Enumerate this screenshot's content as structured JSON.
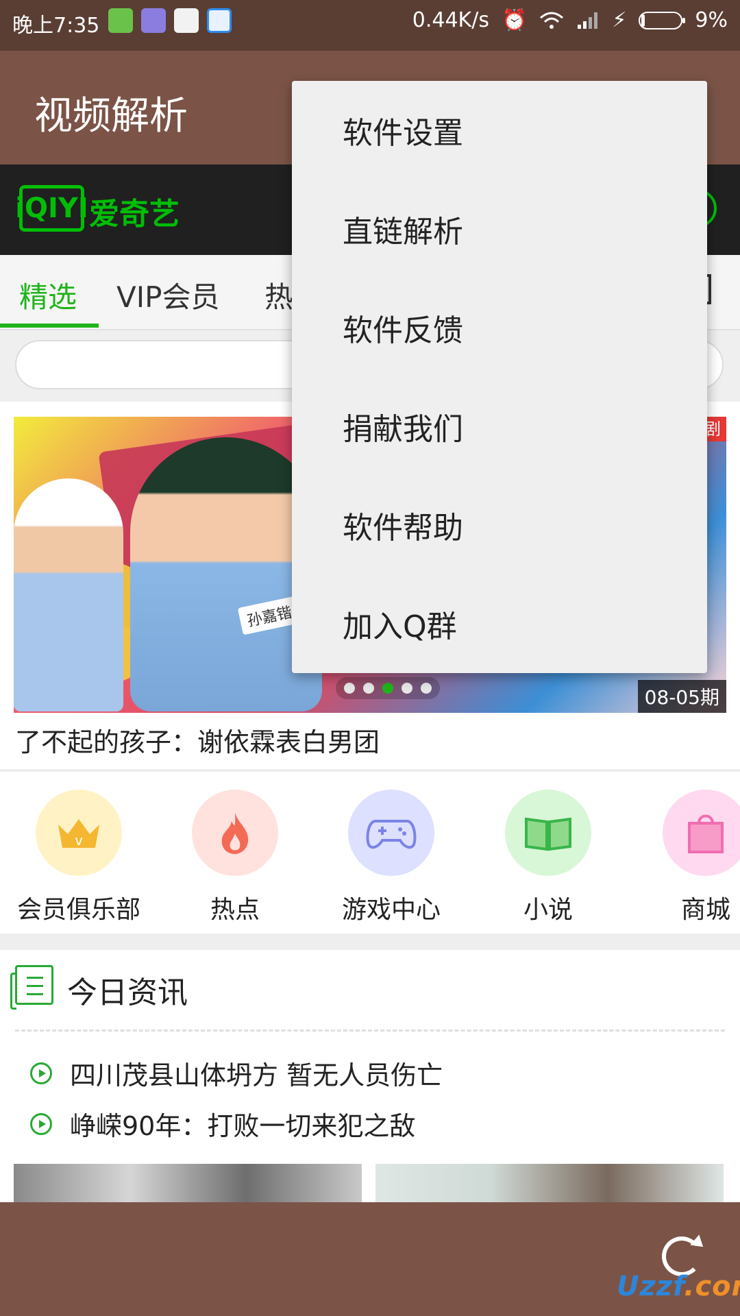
{
  "status_bar": {
    "time": "晚上7:35",
    "network_speed": "0.44K/s",
    "battery_percent": "9%",
    "battery_level": 0.09,
    "icons": [
      "battery-app-icon",
      "launcher-icon",
      "play-store-icon",
      "browser-icon",
      "alarm-icon",
      "wifi-icon",
      "signal-icon",
      "charging-icon"
    ]
  },
  "app_bar": {
    "title": "视频解析"
  },
  "iqiyi": {
    "brand": "爱奇艺",
    "logo_text": "iQIYI"
  },
  "tabs": [
    {
      "label": "精选",
      "active": true
    },
    {
      "label": "VIP会员",
      "active": false
    },
    {
      "label": "热",
      "active": false
    }
  ],
  "banner": {
    "episode": "08-05期",
    "caption": "了不起的孩子：谢依霖表白男团",
    "name_tag": "孙嘉锴",
    "corner_badge": "剧",
    "dot_count": 5,
    "active_dot": 3
  },
  "categories": [
    {
      "label": "会员俱乐部",
      "icon": "crown-icon",
      "bg": "#fff3c6",
      "color": "#f5b731"
    },
    {
      "label": "热点",
      "icon": "flame-icon",
      "bg": "#ffe1de",
      "color": "#f36a55"
    },
    {
      "label": "游戏中心",
      "icon": "gamepad-icon",
      "bg": "#dde0ff",
      "color": "#7b84e6"
    },
    {
      "label": "小说",
      "icon": "book-icon",
      "bg": "#d8f7d6",
      "color": "#39b54a"
    },
    {
      "label": "商城",
      "icon": "shopping-bag-icon",
      "bg": "#ffd9ef",
      "color": "#f06db0"
    }
  ],
  "news": {
    "title": "今日资讯",
    "items": [
      "四川茂县山体坍方 暂无人员伤亡",
      "峥嵘90年：打败一切来犯之敌"
    ]
  },
  "menu": {
    "items": [
      "软件设置",
      "直链解析",
      "软件反馈",
      "捐献我们",
      "软件帮助",
      "加入Q群"
    ]
  },
  "watermark": {
    "main": "Uzzf",
    "suffix": ".com"
  },
  "colors": {
    "status_bar": "#5a3e34",
    "app_bar": "#7b5447",
    "accent_green": "#1fb41a",
    "iqiyi_green": "#00be06",
    "menu_bg": "#efefef"
  }
}
